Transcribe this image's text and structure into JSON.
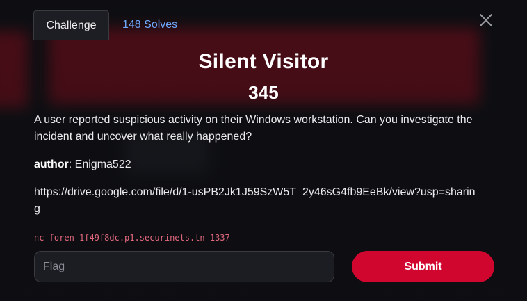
{
  "tabs": {
    "challenge_label": "Challenge",
    "solves_label": "148 Solves"
  },
  "challenge": {
    "title": "Silent Visitor",
    "points": "345",
    "description": "A user reported suspicious activity on their Windows workstation. Can you investigate the incident and uncover what really happened?",
    "author_label": "author",
    "author_name": ": Enigma522",
    "link": "https://drive.google.com/file/d/1-usPB2Jk1J59SzW5T_2y46sG4fb9EeBk/view?usp=sharing",
    "connection": "nc foren-1f49f8dc.p1.securinets.tn 1337"
  },
  "form": {
    "flag_placeholder": "Flag",
    "flag_value": "",
    "submit_label": "Submit"
  },
  "icons": {
    "close": "close-icon"
  },
  "colors": {
    "accent": "#d1062f",
    "link_blue": "#6ea8fe",
    "command_pink": "#e3687e",
    "background": "#0d0e12"
  }
}
